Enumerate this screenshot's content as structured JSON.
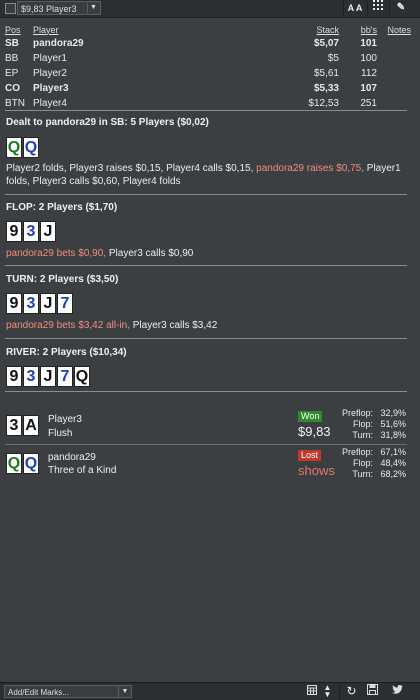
{
  "toolbar": {
    "hand_select": "$9,83 Player3",
    "font_button": "A A",
    "grid_icon": "grid-icon",
    "edit_icon": "pencil-icon"
  },
  "players_table": {
    "headers": [
      "Pos",
      "Player",
      "Stack",
      "bb's",
      "Notes"
    ],
    "rows": [
      {
        "pos": "SB",
        "player": "pandora29",
        "stack": "$5,07",
        "bbs": "101",
        "bold": true
      },
      {
        "pos": "BB",
        "player": "Player1",
        "stack": "$5",
        "bbs": "100",
        "bold": false
      },
      {
        "pos": "EP",
        "player": "Player2",
        "stack": "$5,61",
        "bbs": "112",
        "bold": false
      },
      {
        "pos": "CO",
        "player": "Player3",
        "stack": "$5,33",
        "bbs": "107",
        "bold": true
      },
      {
        "pos": "BTN",
        "player": "Player4",
        "stack": "$12,53",
        "bbs": "251",
        "bold": false
      }
    ]
  },
  "preflop": {
    "header": "Dealt to pandora29 in SB: 5 Players ($0,02)",
    "cards": [
      {
        "rank": "Q",
        "suit": "clubs"
      },
      {
        "rank": "Q",
        "suit": "diamonds"
      }
    ],
    "action_a": "Player2 folds, Player3 raises $0,15, Player4 calls $0,15, ",
    "action_hero": "pandora29 raises $0,75,",
    "action_b": " Player1",
    "action_c": "folds, Player3 calls $0,60, Player4 folds"
  },
  "flop": {
    "header": "FLOP: 2 Players ($1,70)",
    "cards": [
      {
        "rank": "9",
        "suit": "spades"
      },
      {
        "rank": "3",
        "suit": "diamonds"
      },
      {
        "rank": "J",
        "suit": "spades"
      }
    ],
    "action_hero": "pandora29 bets $0,90,",
    "action_other": " Player3 calls $0,90"
  },
  "turn": {
    "header": "TURN: 2 Players ($3,50)",
    "cards": [
      {
        "rank": "9",
        "suit": "spades"
      },
      {
        "rank": "3",
        "suit": "diamonds"
      },
      {
        "rank": "J",
        "suit": "spades"
      },
      {
        "rank": "7",
        "suit": "diamonds"
      }
    ],
    "action_hero": "pandora29 bets $3,42 all-in,",
    "action_other": " Player3 calls $3,42"
  },
  "river": {
    "header": "RIVER: 2 Players ($10,34)",
    "cards": [
      {
        "rank": "9",
        "suit": "spades"
      },
      {
        "rank": "3",
        "suit": "diamonds"
      },
      {
        "rank": "J",
        "suit": "spades"
      },
      {
        "rank": "7",
        "suit": "diamonds"
      },
      {
        "rank": "Q",
        "suit": "spades"
      }
    ]
  },
  "results": [
    {
      "cards": [
        {
          "rank": "3",
          "suit": "spades"
        },
        {
          "rank": "A",
          "suit": "spades"
        }
      ],
      "player": "Player3",
      "hand": "Flush",
      "badge": "Won",
      "amount": "$9,83",
      "stats": [
        {
          "label": "Preflop:",
          "value": "32,9%"
        },
        {
          "label": "Flop:",
          "value": "51,6%"
        },
        {
          "label": "Turn:",
          "value": "31,8%"
        }
      ]
    },
    {
      "cards": [
        {
          "rank": "Q",
          "suit": "clubs"
        },
        {
          "rank": "Q",
          "suit": "diamonds"
        }
      ],
      "player": "pandora29",
      "hand": "Three of a Kind",
      "badge": "Lost",
      "amount": "shows",
      "stats": [
        {
          "label": "Preflop:",
          "value": "67,1%"
        },
        {
          "label": "Flop:",
          "value": "48,4%"
        },
        {
          "label": "Turn:",
          "value": "68,2%"
        }
      ]
    }
  ],
  "bottom": {
    "marks_label": "Add/Edit Marks...",
    "icons": [
      "calendar-icon",
      "sort-icon",
      "refresh-icon",
      "save-icon",
      "twitter-icon"
    ]
  },
  "colors": {
    "background": "#3c3f42",
    "hero_action": "#ef8d7d",
    "won": "#2f8a2b",
    "lost": "#c0392b"
  }
}
